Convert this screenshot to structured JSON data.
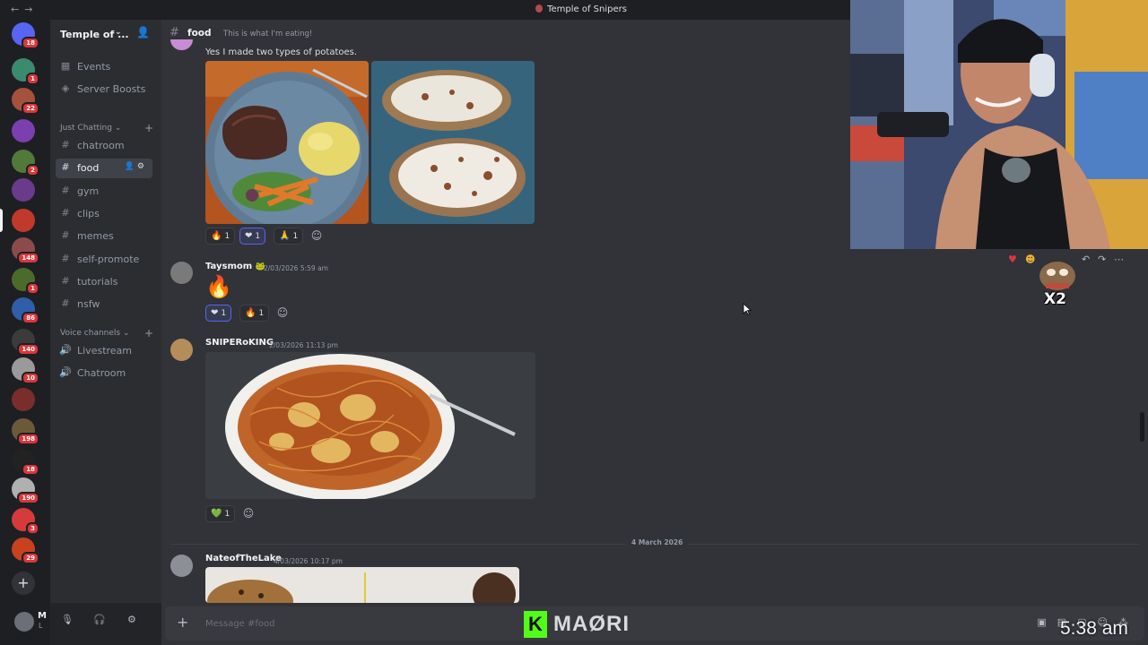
{
  "window": {
    "title": "Temple of Snipers",
    "back_label": "←",
    "forward_label": "→"
  },
  "servers": [
    {
      "name": "direct-messages",
      "badge": "18",
      "color": "#5865f2"
    },
    {
      "name": "server-2",
      "badge": "1",
      "color": "#3a8a6e"
    },
    {
      "name": "server-3",
      "badge": "22",
      "color": "#a5523c"
    },
    {
      "name": "server-4",
      "badge": "",
      "color": "#7b3fb0"
    },
    {
      "name": "server-5",
      "badge": "2",
      "color": "#4f7a3a"
    },
    {
      "name": "server-6",
      "badge": "",
      "color": "#6a3b8c"
    },
    {
      "name": "temple-of-snipers",
      "badge": "",
      "color": "#c0392b"
    },
    {
      "name": "server-8",
      "badge": "148",
      "color": "#8c4b4b"
    },
    {
      "name": "server-9",
      "badge": "1",
      "color": "#4a6b2a"
    },
    {
      "name": "server-10",
      "badge": "86",
      "color": "#2f5fa8"
    },
    {
      "name": "server-11",
      "badge": "140",
      "color": "#3b3b3b"
    },
    {
      "name": "server-12",
      "badge": "10",
      "color": "#9a9a9a"
    },
    {
      "name": "server-13",
      "badge": "",
      "color": "#7a2d2d"
    },
    {
      "name": "server-14",
      "badge": "198",
      "color": "#6b5a3a"
    },
    {
      "name": "server-15",
      "badge": "18",
      "color": "#222222"
    },
    {
      "name": "server-16",
      "badge": "190",
      "color": "#b0b0b0"
    },
    {
      "name": "server-17",
      "badge": "3",
      "color": "#d63b3b"
    },
    {
      "name": "server-18",
      "badge": "29",
      "color": "#c8421f"
    }
  ],
  "guild": {
    "name": "Temple of ...",
    "chevron": "⌄"
  },
  "sidebar": {
    "top_items": [
      {
        "label": "Events",
        "icon": "calendar-icon",
        "glyph": "▦"
      },
      {
        "label": "Server Boosts",
        "icon": "boost-icon",
        "glyph": "◈"
      }
    ],
    "text_category": "Just Chatting ⌄",
    "channels": [
      {
        "label": "chatroom"
      },
      {
        "label": "food",
        "active": true
      },
      {
        "label": "gym"
      },
      {
        "label": "clips"
      },
      {
        "label": "memes"
      },
      {
        "label": "self-promote"
      },
      {
        "label": "tutorials"
      },
      {
        "label": "nsfw"
      }
    ],
    "voice_category": "Voice channels ⌄",
    "voice_channels": [
      {
        "label": "Livestream"
      },
      {
        "label": "Chatroom"
      }
    ]
  },
  "user_panel": {
    "name": "M",
    "status": "L"
  },
  "channel_header": {
    "name": "food",
    "topic": "This is what I'm eating!"
  },
  "messages": [
    {
      "text": "Yes I made two types of potatoes.",
      "reactions": [
        {
          "emoji": "🔥",
          "count": "1"
        },
        {
          "emoji": "❤",
          "count": "1",
          "me": true
        },
        {
          "emoji": "🙏",
          "count": "1"
        }
      ]
    },
    {
      "author": "Taysmom",
      "badge": "🐸",
      "timestamp": "2/03/2026 5:59 am",
      "text": "🔥",
      "reactions": [
        {
          "emoji": "❤",
          "count": "1",
          "me": true
        },
        {
          "emoji": "🔥",
          "count": "1"
        }
      ]
    },
    {
      "author": "SNIPERoKING",
      "timestamp": "2/03/2026 11:13 pm",
      "reactions": [
        {
          "emoji": "💚",
          "count": "1"
        }
      ]
    },
    {
      "author": "NateofTheLake",
      "timestamp": "4/03/2026 10:17 pm"
    }
  ],
  "date_divider": "4 March 2026",
  "composer": {
    "placeholder": "Message #food"
  },
  "overlay": {
    "logo_letter": "K",
    "logo_text": "MAØRI",
    "clock": "5:38 am",
    "x2_label": "X2"
  }
}
